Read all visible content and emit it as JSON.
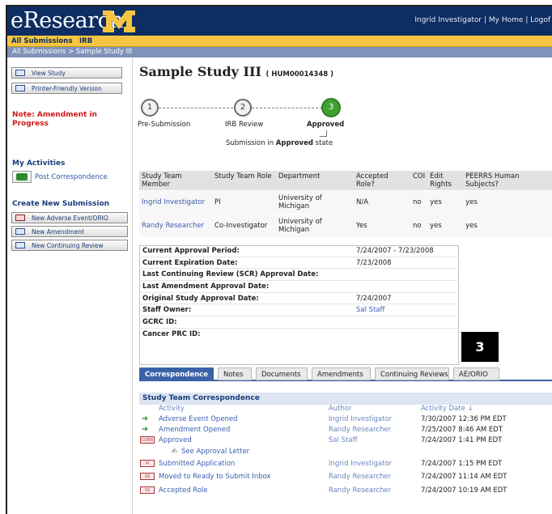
{
  "header": {
    "logo_text": "eResearch",
    "logo_mark": "M",
    "user_name": "Ingrid Investigator",
    "separator": "|",
    "my_home": "My Home",
    "logoff": "Logof"
  },
  "nav_tabs": [
    "All Submissions",
    "IRB"
  ],
  "breadcrumb": "All Submissions  >  Sample Study III",
  "sidebar": {
    "buttons": [
      {
        "label": "View Study",
        "icon": "view-icon"
      },
      {
        "label": "Printer-Friendly Version",
        "icon": "printer-icon"
      }
    ],
    "note": "Note: Amendment in Progress",
    "my_activities_heading": "My Activities",
    "post_correspondence": "Post Correspondence",
    "create_heading": "Create New Submission",
    "create_buttons": [
      {
        "label": "New Adverse Event/ORIO",
        "icon": "adverse-event-icon"
      },
      {
        "label": "New Amendment",
        "icon": "amendment-icon"
      },
      {
        "label": "New Continuing Review",
        "icon": "continuing-review-icon"
      }
    ]
  },
  "study": {
    "title": "Sample Study III",
    "id_text": "( HUM00014348 )"
  },
  "progress": {
    "steps": [
      {
        "num": "1",
        "label": "Pre-Submission"
      },
      {
        "num": "2",
        "label": "IRB Review"
      },
      {
        "num": "3",
        "label": "Approved"
      }
    ],
    "state_prefix": "Submission in ",
    "state_value": "Approved",
    "state_suffix": " state"
  },
  "team_table": {
    "headers": [
      "Study Team Member",
      "Study Team Role",
      "Department",
      "Accepted Role?",
      "COI",
      "Edit Rights",
      "PEERRS Human Subjects?"
    ],
    "rows": [
      [
        "Ingrid Investigator",
        "PI",
        "University of Michigan",
        "N/A",
        "no",
        "yes",
        "yes"
      ],
      [
        "Randy Researcher",
        "Co-Investigator",
        "University of Michigan",
        "Yes",
        "no",
        "yes",
        "yes"
      ]
    ]
  },
  "approval_info": [
    {
      "key": "Current Approval Period:",
      "value": "7/24/2007 - 7/23/2008"
    },
    {
      "key": "Current Expiration Date:",
      "value": "7/23/2008"
    },
    {
      "key": "Last Continuing Review (SCR) Approval Date:",
      "value": ""
    },
    {
      "key": "Last Amendment Approval Date:",
      "value": ""
    },
    {
      "key": "Original Study Approval Date:",
      "value": "7/24/2007"
    },
    {
      "key": "Staff Owner:",
      "value": "Sal Staff"
    },
    {
      "key": "GCRC ID:",
      "value": ""
    },
    {
      "key": "Cancer PRC ID:",
      "value": ""
    }
  ],
  "callout_number": "3",
  "tabs": [
    "Correspondence",
    "Notes",
    "Documents",
    "Amendments",
    "Continuing Reviews",
    "AE/ORIO"
  ],
  "correspondence": {
    "heading": "Study Team Correspondence",
    "columns": [
      "Activity",
      "Author",
      "Activity Date ↓"
    ],
    "rows": [
      {
        "activity": "Adverse Event Opened",
        "author": "Ingrid Investigator",
        "date": "7/30/2007 12:36 PM EDT",
        "icon": "arrow-icon",
        "badge": ""
      },
      {
        "activity": "Amendment Opened",
        "author": "Randy Researcher",
        "date": "7/25/2007 8:46 AM EDT",
        "icon": "arrow-icon",
        "badge": ""
      },
      {
        "activity": "Approved",
        "author": "Sal Staff",
        "date": "7/24/2007 1:41 PM EDT",
        "icon": "document-icon",
        "badge": "CORR"
      },
      {
        "activity": "See Approval Letter",
        "author": "",
        "date": "",
        "icon": "letter-icon",
        "badge": ""
      },
      {
        "activity": "Submitted Application",
        "author": "Ingrid Investigator",
        "date": "7/24/2007 1:15 PM EDT",
        "icon": "document-icon",
        "badge": "PI"
      },
      {
        "activity": "Moved to Ready to Submit Inbox",
        "author": "Randy Researcher",
        "date": "7/24/2007 11:14 AM EDT",
        "icon": "document-icon",
        "badge": "SS"
      },
      {
        "activity": "Accepted Role",
        "author": "Randy Researcher",
        "date": "7/24/2007 10:19 AM EDT",
        "icon": "document-icon",
        "badge": "SS"
      }
    ]
  },
  "colors": {
    "header_navy": "#0e2d63",
    "nav_yellow": "#f5c542",
    "tab_active_blue": "#3a62a8",
    "link_blue": "#3a5fb0",
    "approved_green": "#3fa22f",
    "note_red": "#d01818"
  }
}
